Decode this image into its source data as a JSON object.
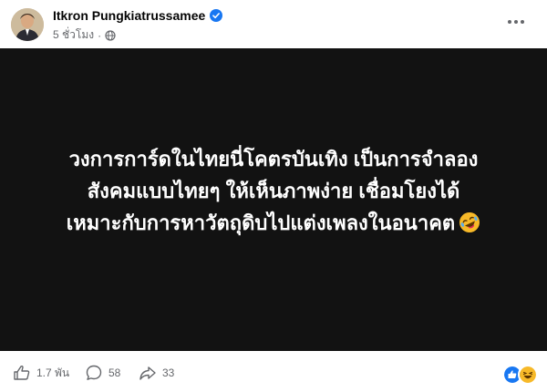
{
  "post": {
    "author": "Itkron Pungkiatrussamee",
    "timestamp": "5 ชั่วโมง",
    "text": "วงการการ์ดในไทยนี่โคตรบันเทิง เป็นการจำลองสังคมแบบไทยๆ ให้เห็นภาพง่าย เชื่อมโยงได้ เหมาะกับการหาวัตถุดิบไปแต่งเพลงในอนาคต",
    "card_background": "#121212"
  },
  "stats": {
    "likes": "1.7 พัน",
    "comments": "58",
    "shares": "33"
  },
  "colors": {
    "verified": "#1877f2",
    "like_reaction": "#1877f2",
    "haha_reaction": "#f7b928"
  },
  "icons": {
    "verified": "verified-badge-icon",
    "visibility": "globe-icon",
    "more": "more-options-icon",
    "like": "thumbs-up-icon",
    "comment": "comment-bubble-icon",
    "share": "share-arrow-icon",
    "emoji": "rolling-laughing-emoji-icon"
  }
}
